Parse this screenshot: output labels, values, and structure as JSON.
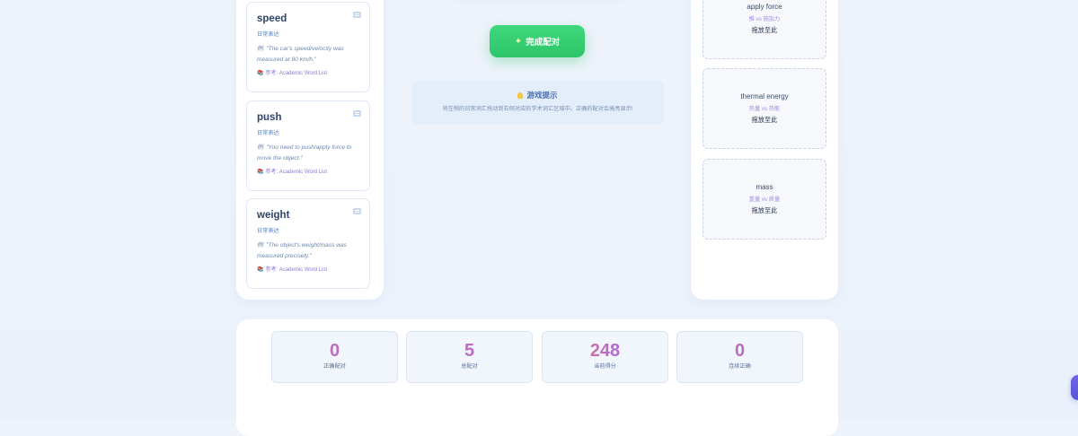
{
  "word_cards": [
    {
      "word": "speed",
      "tag": "日常表达",
      "example": "例: \"The car's speed/velocity was measured at 80 km/h.\"",
      "ref": "参考: Academic Word List"
    },
    {
      "word": "push",
      "tag": "日常表达",
      "example": "例: \"You need to push/apply force to move the object.\"",
      "ref": "参考: Academic Word List"
    },
    {
      "word": "weight",
      "tag": "日常表达",
      "example": "例: \"The object's weight/mass was measured precisely.\"",
      "ref": "参考: Academic Word List"
    }
  ],
  "finish_button": {
    "icon": "sparkle-icon",
    "label": "完成配对"
  },
  "tip": {
    "icon": "lightbulb-icon",
    "title": "游戏提示",
    "text": "将左侧的日常词汇拖动到右侧对应的学术词汇区域中。正确的配对会高亮显示!"
  },
  "drop_zones": [
    {
      "term": "apply force",
      "compare": "推 vs 施加力",
      "hint": "拖放至此"
    },
    {
      "term": "thermal energy",
      "compare": "热量 vs 热能",
      "hint": "拖放至此"
    },
    {
      "term": "mass",
      "compare": "重量 vs 质量",
      "hint": "拖放至此"
    }
  ],
  "stats": [
    {
      "value": "0",
      "label": "正确配对"
    },
    {
      "value": "5",
      "label": "总配对"
    },
    {
      "value": "248",
      "label": "当前得分"
    },
    {
      "value": "0",
      "label": "连续正确"
    }
  ],
  "colors": {
    "accent_green": "#2ec56a",
    "card_border": "#dfe8f7",
    "stat_gradient_start": "#e8814e",
    "stat_gradient_end": "#8c6fe0"
  }
}
